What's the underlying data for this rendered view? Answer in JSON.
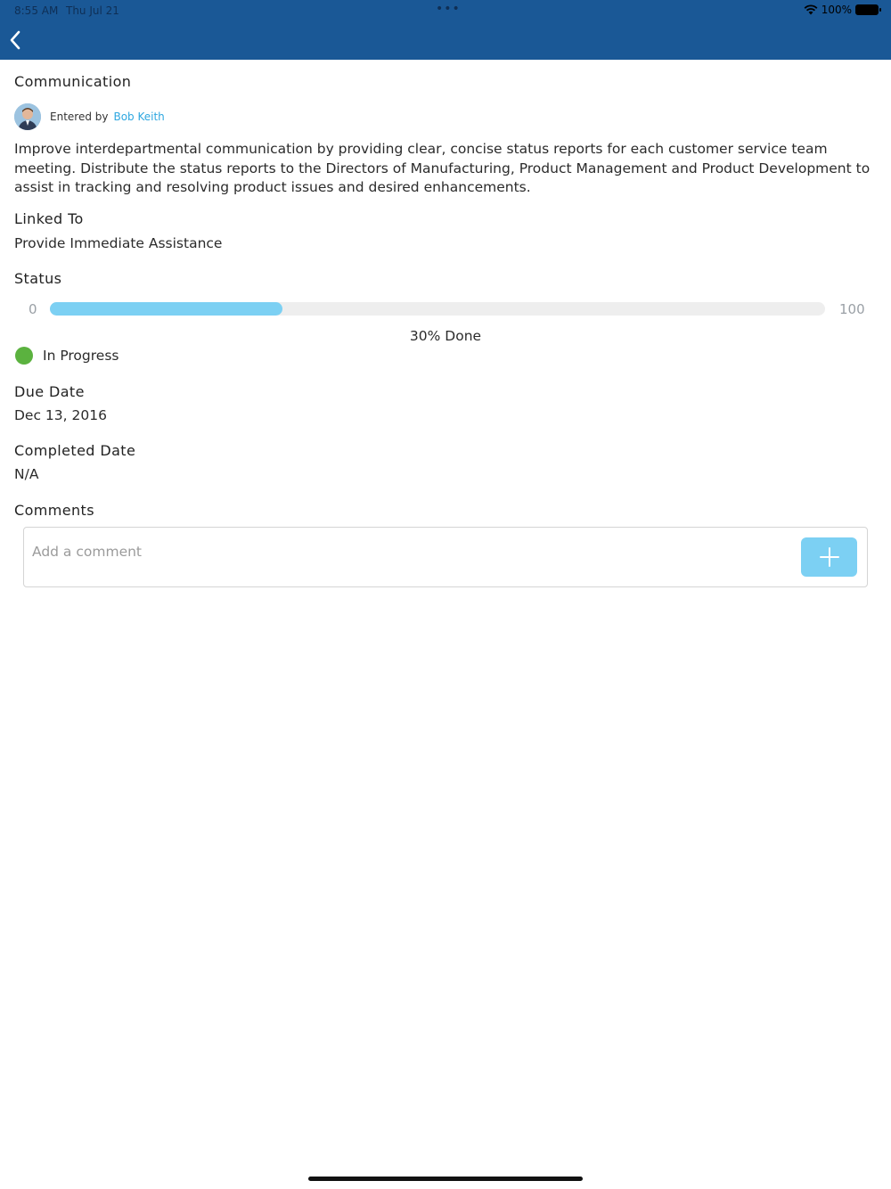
{
  "status_bar": {
    "time": "8:55 AM",
    "date": "Thu Jul 21",
    "battery": "100%",
    "icons": [
      "wifi-icon",
      "battery-icon"
    ]
  },
  "header": {
    "background": "#1a5896",
    "back_icon": "chevron-left-icon"
  },
  "goal": {
    "title": "Communication",
    "entered_by_label": "Entered by",
    "entered_by_name": "Bob Keith",
    "description": "Improve interdepartmental communication by providing clear, concise status reports for each customer service team meeting. Distribute the status reports to the Directors of Manufacturing, Product Management and Product Development to assist in tracking and resolving product issues and desired enhancements."
  },
  "linked_to": {
    "label": "Linked To",
    "value": "Provide Immediate Assistance"
  },
  "status": {
    "label": "Status",
    "min": "0",
    "max": "100",
    "progress_percent": 30,
    "progress_text": "30% Done",
    "state": "In Progress",
    "state_color": "#5bb23f",
    "bar_color": "#7cd0f3"
  },
  "due_date": {
    "label": "Due Date",
    "value": "Dec 13, 2016"
  },
  "completed_date": {
    "label": "Completed Date",
    "value": "N/A"
  },
  "comments": {
    "label": "Comments",
    "placeholder": "Add a comment",
    "add_icon": "plus-icon"
  }
}
